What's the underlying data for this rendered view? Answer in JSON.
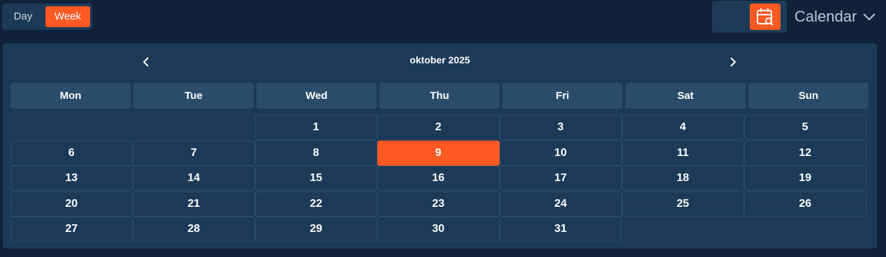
{
  "view_toggle": {
    "day_label": "Day",
    "week_label": "Week",
    "active": "Week"
  },
  "view_mode": {
    "grid_icon": "layout-grid-icon",
    "calendar_icon": "calendar-search-icon",
    "active": "calendar"
  },
  "calendar_dropdown": {
    "label": "Calendar",
    "icon": "chevron-down-icon"
  },
  "calendar": {
    "month_title": "oktober 2025",
    "prev_icon": "chevron-left-icon",
    "next_icon": "chevron-right-icon",
    "weekdays": [
      "Mon",
      "Tue",
      "Wed",
      "Thu",
      "Fri",
      "Sat",
      "Sun"
    ],
    "weeks": [
      [
        "",
        "",
        "1",
        "2",
        "3",
        "4",
        "5"
      ],
      [
        "6",
        "7",
        "8",
        "9",
        "10",
        "11",
        "12"
      ],
      [
        "13",
        "14",
        "15",
        "16",
        "17",
        "18",
        "19"
      ],
      [
        "20",
        "21",
        "22",
        "23",
        "24",
        "25",
        "26"
      ],
      [
        "27",
        "28",
        "29",
        "30",
        "31",
        "",
        ""
      ]
    ],
    "selected_day": "9"
  },
  "colors": {
    "accent": "#fe5a22",
    "background": "#10213a",
    "panel": "#1c3a57",
    "header_cell": "#2a4c6b"
  }
}
